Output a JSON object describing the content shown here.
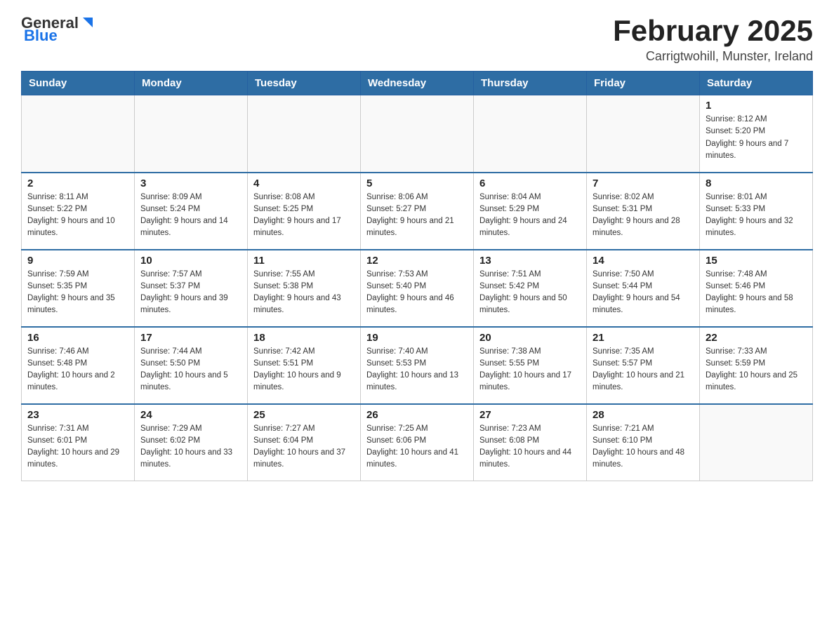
{
  "header": {
    "logo": {
      "general": "General",
      "blue": "Blue"
    },
    "title": "February 2025",
    "location": "Carrigtwohill, Munster, Ireland"
  },
  "days_of_week": [
    "Sunday",
    "Monday",
    "Tuesday",
    "Wednesday",
    "Thursday",
    "Friday",
    "Saturday"
  ],
  "weeks": [
    [
      {
        "day": "",
        "info": ""
      },
      {
        "day": "",
        "info": ""
      },
      {
        "day": "",
        "info": ""
      },
      {
        "day": "",
        "info": ""
      },
      {
        "day": "",
        "info": ""
      },
      {
        "day": "",
        "info": ""
      },
      {
        "day": "1",
        "info": "Sunrise: 8:12 AM\nSunset: 5:20 PM\nDaylight: 9 hours and 7 minutes."
      }
    ],
    [
      {
        "day": "2",
        "info": "Sunrise: 8:11 AM\nSunset: 5:22 PM\nDaylight: 9 hours and 10 minutes."
      },
      {
        "day": "3",
        "info": "Sunrise: 8:09 AM\nSunset: 5:24 PM\nDaylight: 9 hours and 14 minutes."
      },
      {
        "day": "4",
        "info": "Sunrise: 8:08 AM\nSunset: 5:25 PM\nDaylight: 9 hours and 17 minutes."
      },
      {
        "day": "5",
        "info": "Sunrise: 8:06 AM\nSunset: 5:27 PM\nDaylight: 9 hours and 21 minutes."
      },
      {
        "day": "6",
        "info": "Sunrise: 8:04 AM\nSunset: 5:29 PM\nDaylight: 9 hours and 24 minutes."
      },
      {
        "day": "7",
        "info": "Sunrise: 8:02 AM\nSunset: 5:31 PM\nDaylight: 9 hours and 28 minutes."
      },
      {
        "day": "8",
        "info": "Sunrise: 8:01 AM\nSunset: 5:33 PM\nDaylight: 9 hours and 32 minutes."
      }
    ],
    [
      {
        "day": "9",
        "info": "Sunrise: 7:59 AM\nSunset: 5:35 PM\nDaylight: 9 hours and 35 minutes."
      },
      {
        "day": "10",
        "info": "Sunrise: 7:57 AM\nSunset: 5:37 PM\nDaylight: 9 hours and 39 minutes."
      },
      {
        "day": "11",
        "info": "Sunrise: 7:55 AM\nSunset: 5:38 PM\nDaylight: 9 hours and 43 minutes."
      },
      {
        "day": "12",
        "info": "Sunrise: 7:53 AM\nSunset: 5:40 PM\nDaylight: 9 hours and 46 minutes."
      },
      {
        "day": "13",
        "info": "Sunrise: 7:51 AM\nSunset: 5:42 PM\nDaylight: 9 hours and 50 minutes."
      },
      {
        "day": "14",
        "info": "Sunrise: 7:50 AM\nSunset: 5:44 PM\nDaylight: 9 hours and 54 minutes."
      },
      {
        "day": "15",
        "info": "Sunrise: 7:48 AM\nSunset: 5:46 PM\nDaylight: 9 hours and 58 minutes."
      }
    ],
    [
      {
        "day": "16",
        "info": "Sunrise: 7:46 AM\nSunset: 5:48 PM\nDaylight: 10 hours and 2 minutes."
      },
      {
        "day": "17",
        "info": "Sunrise: 7:44 AM\nSunset: 5:50 PM\nDaylight: 10 hours and 5 minutes."
      },
      {
        "day": "18",
        "info": "Sunrise: 7:42 AM\nSunset: 5:51 PM\nDaylight: 10 hours and 9 minutes."
      },
      {
        "day": "19",
        "info": "Sunrise: 7:40 AM\nSunset: 5:53 PM\nDaylight: 10 hours and 13 minutes."
      },
      {
        "day": "20",
        "info": "Sunrise: 7:38 AM\nSunset: 5:55 PM\nDaylight: 10 hours and 17 minutes."
      },
      {
        "day": "21",
        "info": "Sunrise: 7:35 AM\nSunset: 5:57 PM\nDaylight: 10 hours and 21 minutes."
      },
      {
        "day": "22",
        "info": "Sunrise: 7:33 AM\nSunset: 5:59 PM\nDaylight: 10 hours and 25 minutes."
      }
    ],
    [
      {
        "day": "23",
        "info": "Sunrise: 7:31 AM\nSunset: 6:01 PM\nDaylight: 10 hours and 29 minutes."
      },
      {
        "day": "24",
        "info": "Sunrise: 7:29 AM\nSunset: 6:02 PM\nDaylight: 10 hours and 33 minutes."
      },
      {
        "day": "25",
        "info": "Sunrise: 7:27 AM\nSunset: 6:04 PM\nDaylight: 10 hours and 37 minutes."
      },
      {
        "day": "26",
        "info": "Sunrise: 7:25 AM\nSunset: 6:06 PM\nDaylight: 10 hours and 41 minutes."
      },
      {
        "day": "27",
        "info": "Sunrise: 7:23 AM\nSunset: 6:08 PM\nDaylight: 10 hours and 44 minutes."
      },
      {
        "day": "28",
        "info": "Sunrise: 7:21 AM\nSunset: 6:10 PM\nDaylight: 10 hours and 48 minutes."
      },
      {
        "day": "",
        "info": ""
      }
    ]
  ]
}
